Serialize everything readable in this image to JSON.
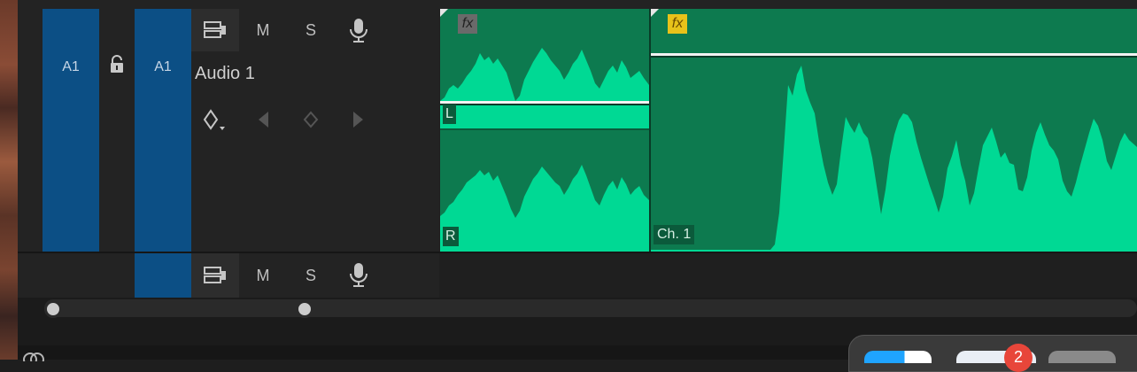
{
  "track": {
    "target_left": "A1",
    "target_right": "A1",
    "name": "Audio 1",
    "mute": "M",
    "solo": "S"
  },
  "sub_controls": {
    "mute": "M",
    "solo": "S"
  },
  "clips": {
    "clip1": {
      "fx_label": "fx",
      "left_channel": "L",
      "right_channel": "R"
    },
    "clip2": {
      "fx_label": "fx",
      "channel_label": "Ch. 1"
    }
  },
  "dock": {
    "badge_count": "2"
  },
  "colors": {
    "track_target": "#0c4f85",
    "clip": "#0d7a4f",
    "waveform": "#00d994",
    "fx_active": "#e8c21a",
    "fx_inactive": "#6a6a6a"
  }
}
